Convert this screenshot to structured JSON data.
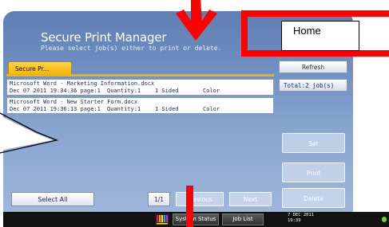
{
  "header": {
    "title": "Secure Print Manager",
    "subtitle": "Please select job(s) either to print or delete."
  },
  "tab": {
    "label": "Secure Pr..."
  },
  "refresh_label": "Refresh",
  "total_label": "Total:2 job(s)",
  "jobs": [
    {
      "name": "Microsoft Word - Marketing Information.docx",
      "date": "Dec 07 2011 19:34:36 page:1",
      "quantity": "Quantity:1",
      "sides": "1 Sided",
      "color": "Color"
    },
    {
      "name": "Microsoft Word - New Starter Form.docx",
      "date": "Dec 07 2011 19:36:13 page:1",
      "quantity": "Quantity:1",
      "sides": "1 Sided",
      "color": "Color"
    }
  ],
  "side_buttons": {
    "set": "Set",
    "print": "Print",
    "delete": "Delete"
  },
  "footer": {
    "select_all": "Select All",
    "page": "1/1",
    "previous": "Previous",
    "next": "Next"
  },
  "status_bar": {
    "system_status": "System Status",
    "job_list": "Job List",
    "date": "7 DEC 2011",
    "time": "19:39"
  },
  "annotation": {
    "home_label": "Home"
  },
  "colors": {
    "accent_tab": "#f2b400",
    "annotation_red": "#ff0000",
    "screen_blue": "#6f8fc2"
  }
}
